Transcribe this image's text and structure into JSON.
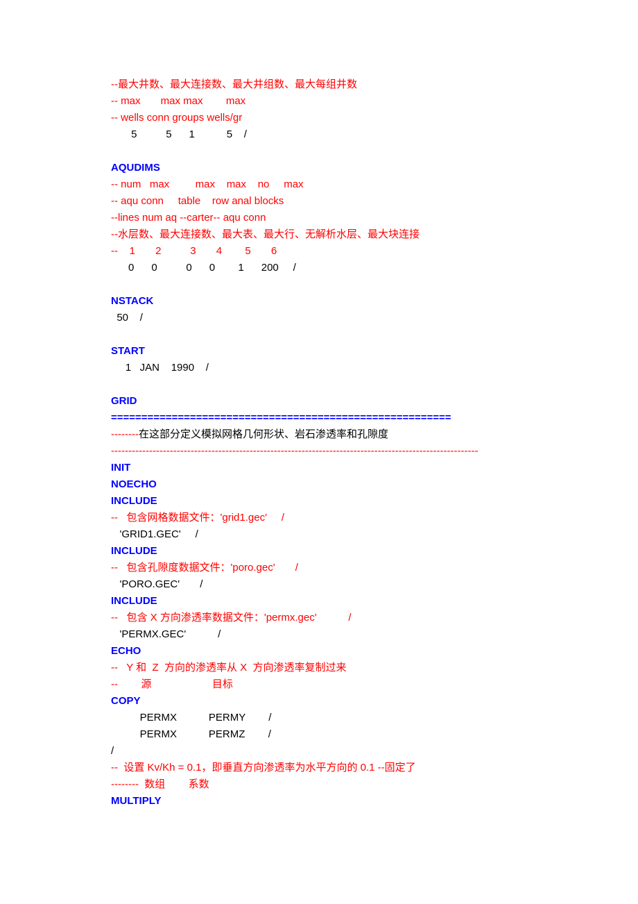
{
  "lines": {
    "l1": "--最大井数、最大连接数、最大井组数、最大每组井数",
    "l2": "-- max       max max        max",
    "l3": "-- wells conn groups wells/gr",
    "l4": "       5          5      1           5    /",
    "l5": "AQUDIMS",
    "l6": "-- num   max         max    max    no     max",
    "l7": "-- aqu conn     table    row anal blocks",
    "l8": "--lines num aq --carter-- aqu conn",
    "l9": "--水层数、最大连接数、最大表、最大行、无解析水层、最大块连接",
    "l10": "--    1       2          3       4        5       6",
    "l11": "      0      0          0      0        1      200     /",
    "l12": "NSTACK",
    "l13": "  50    /",
    "l14": "START",
    "l15": "     1   JAN    1990    /",
    "l16": "GRID",
    "l17": "========================================================",
    "l18a": "--------",
    "l18b": "在这部分定义模拟网格几何形状、岩石渗透率和孔隙度",
    "l19": "----------------------------------------------------------------------------------------------------------",
    "l20": "INIT",
    "l21": "NOECHO",
    "l22": "INCLUDE",
    "l23": "--   包含网格数据文件：'grid1.gec'     /",
    "l24": "   'GRID1.GEC'     /",
    "l25": "INCLUDE",
    "l26": "--   包含孔隙度数据文件：'poro.gec'       /",
    "l27": "   'PORO.GEC'       /",
    "l28": "INCLUDE",
    "l29": "--   包含 X 方向渗透率数据文件：'permx.gec'           /",
    "l30": "   'PERMX.GEC'           /",
    "l31": "ECHO",
    "l32": "--   Y 和  Z  方向的渗透率从 X  方向渗透率复制过来",
    "l33": "--        源                     目标",
    "l34": "COPY",
    "l35": "          PERMX           PERMY        /",
    "l36": "          PERMX           PERMZ        /",
    "l37": "/",
    "l38": "--  设置 Kv/Kh = 0.1，即垂直方向渗透率为水平方向的 0.1 --固定了",
    "l39": "--------  数组        系数",
    "l40": "MULTIPLY"
  }
}
